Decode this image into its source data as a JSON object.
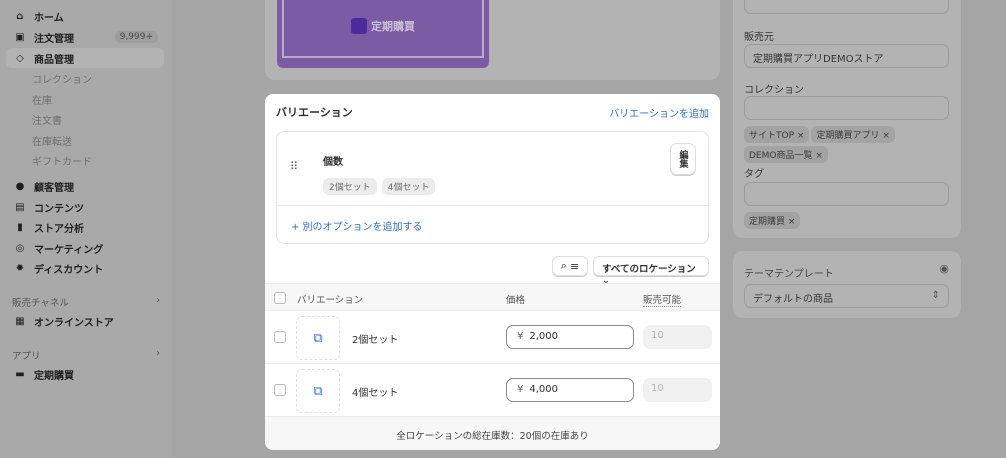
{
  "sidebar": {
    "items": [
      {
        "label": "ホーム",
        "icon": "home-icon"
      },
      {
        "label": "注文管理",
        "icon": "inbox-icon",
        "badge": "9,999+"
      },
      {
        "label": "商品管理",
        "icon": "tag-icon"
      }
    ],
    "sub_items": [
      "コレクション",
      "在庫",
      "注文書",
      "在庫転送",
      "ギフトカード"
    ],
    "items2": [
      {
        "label": "顧客管理",
        "icon": "person-icon"
      },
      {
        "label": "コンテンツ",
        "icon": "content-icon"
      },
      {
        "label": "ストア分析",
        "icon": "bar-chart-icon"
      },
      {
        "label": "マーケティング",
        "icon": "target-icon"
      },
      {
        "label": "ディスカウント",
        "icon": "discount-icon"
      }
    ],
    "sales_channel_header": "販売チャネル",
    "online_store": "オンラインストア",
    "apps_header": "アプリ",
    "app": "定期購買"
  },
  "media": {
    "logo_text": "定期購買",
    "bg_color": "#7a5ba4"
  },
  "variations": {
    "title": "バリエーション",
    "add_link": "バリエーションを追加",
    "option_name": "個数",
    "option_values": [
      "2個セット",
      "4個セット"
    ],
    "edit_button": "編集",
    "add_option": "+ 別のオプションを追加する",
    "location_select": "すべてのロケーション",
    "columns": {
      "variation": "バリエーション",
      "price": "価格",
      "available": "販売可能"
    },
    "rows": [
      {
        "name": "2個セット",
        "currency": "¥",
        "price": "2,000",
        "available": "10"
      },
      {
        "name": "4個セット",
        "currency": "¥",
        "price": "4,000",
        "available": "10"
      }
    ],
    "footer": "全ロケーションの総在庫数：20個の在庫あり"
  },
  "organization": {
    "vendor_label": "販売元",
    "vendor_value": "定期購買アプリDEMOストア",
    "collection_label": "コレクション",
    "collections": [
      "サイトTOP",
      "定期購買アプリ",
      "DEMO商品一覧"
    ],
    "tag_label": "タグ",
    "tags": [
      "定期購買"
    ]
  },
  "theme": {
    "label": "テーマテンプレート",
    "value": "デフォルトの商品"
  }
}
